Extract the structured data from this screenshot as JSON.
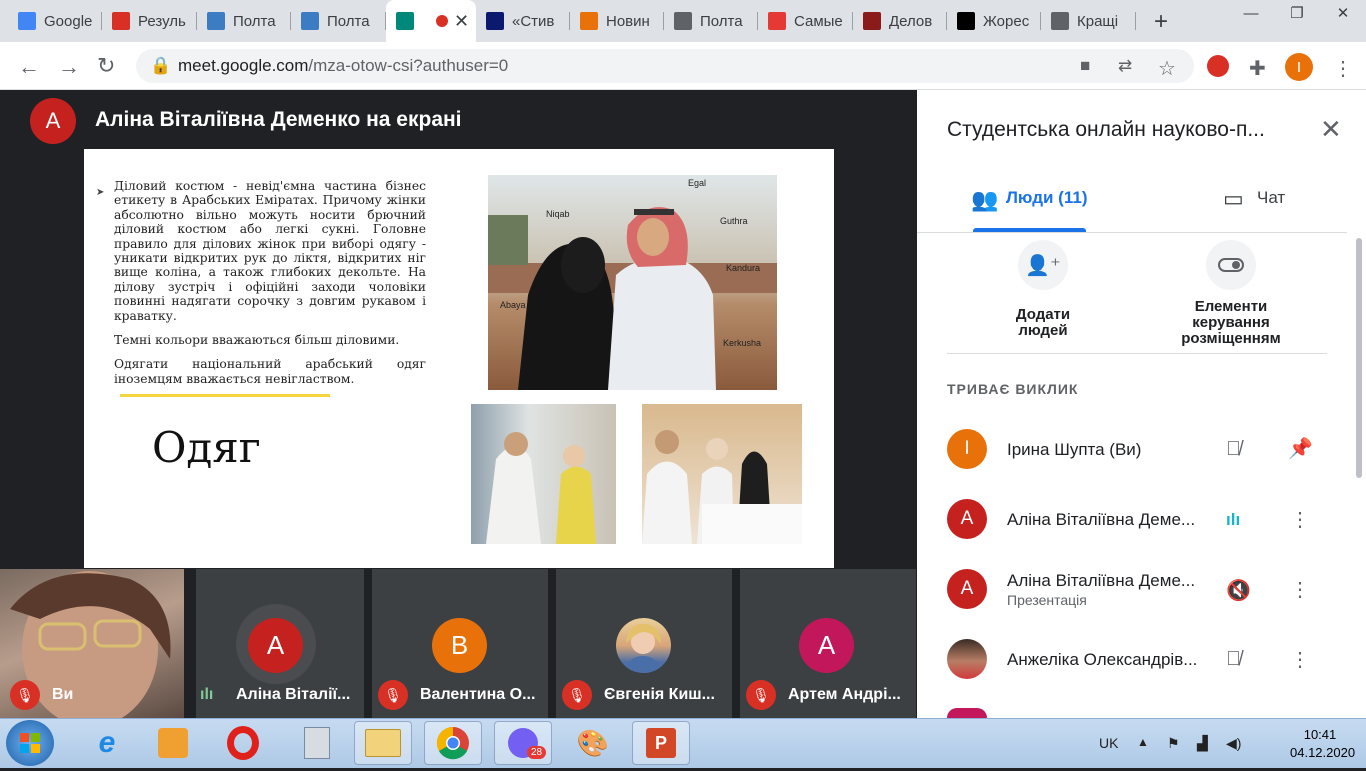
{
  "browser": {
    "tabs": [
      {
        "label": "Google",
        "favicon": "google-icon",
        "color": "#4285f4"
      },
      {
        "label": "Резуль",
        "favicon": "gmail-icon",
        "color": "#d93025"
      },
      {
        "label": "Полта",
        "favicon": "site-4-icon",
        "color": "#3c7cc3"
      },
      {
        "label": "Полта",
        "favicon": "site-4-icon",
        "color": "#3c7cc3"
      },
      {
        "label": "",
        "favicon": "meet-icon",
        "color": "#00897b",
        "active": true
      },
      {
        "label": "«Стив",
        "favicon": "forbes-icon",
        "color": "#0b1a6e"
      },
      {
        "label": "Новин",
        "favicon": "news-icon",
        "color": "#e8710a"
      },
      {
        "label": "Полта",
        "favicon": "globe-icon",
        "color": "#5f6368"
      },
      {
        "label": "Самые",
        "favicon": "card-icon",
        "color": "#e53935"
      },
      {
        "label": "Делов",
        "favicon": "book-icon",
        "color": "#8b1a1a"
      },
      {
        "label": "Жорес",
        "favicon": "wikipedia-icon",
        "color": "#000000"
      },
      {
        "label": "Кращі",
        "favicon": "globe-icon",
        "color": "#5f6368"
      }
    ],
    "url_host": "meet.google.com",
    "url_path": "/mza-otow-csi?authuser=0",
    "profile_initial": "I"
  },
  "presentation": {
    "presenter_initial": "A",
    "title": "Аліна Віталіївна Деменко на екрані",
    "slide": {
      "paragraphs": [
        "Діловий костюм - невід'ємна частина бізнес етикету в Арабських Еміратах. Причому жінки абсолютно вільно можуть носити брючний діловий костюм або легкі сукні. Головне правило для ділових жінок при виборі одягу - уникати відкритих рук до ліктя, відкритих ніг вище коліна, а також глибоких декольте. На ділову зустріч і офіційні заходи чоловіки повинні надягати сорочку з довгим рукавом і краватку.",
        "Темні кольори вважаються більш діловими.",
        "Одягати національний арабський одяг іноземцям вважається невіглаством."
      ],
      "heading": "Одяг",
      "photo_labels": [
        "Egal",
        "Niqab",
        "Guthra",
        "Kandura",
        "Abaya",
        "Kerkusha"
      ]
    }
  },
  "participants_strip": [
    {
      "name": "Ви",
      "initial": "",
      "self": true,
      "muted": true
    },
    {
      "name": "Аліна Віталії...",
      "initial": "A",
      "color": "#c5221f",
      "speaking": true
    },
    {
      "name": "Валентина О...",
      "initial": "B",
      "color": "#e8710a",
      "muted": true
    },
    {
      "name": "Євгенія Киш...",
      "initial": "",
      "photo": true,
      "muted": true
    },
    {
      "name": "Артем Андрі...",
      "initial": "A",
      "color": "#c2185b",
      "muted": true
    }
  ],
  "panel": {
    "title": "Студентська онлайн науково-п...",
    "tab_people": "Люди (11)",
    "tab_chat": "Чат",
    "add_people": "Додати людей",
    "layout_controls": "Елементи керування розміщенням",
    "section_heading": "ТРИВАЄ ВИКЛИК",
    "people": [
      {
        "name": "Ірина Шупта (Ви)",
        "initial": "I",
        "color": "#e8710a",
        "sub": ""
      },
      {
        "name": "Аліна Віталіївна Деме...",
        "initial": "A",
        "color": "#c5221f",
        "sub": ""
      },
      {
        "name": "Аліна Віталіївна Деме...",
        "initial": "A",
        "color": "#c5221f",
        "sub": "Презентація"
      },
      {
        "name": "Анжеліка Олександрів...",
        "initial": "",
        "color": "#6d4c41",
        "sub": ""
      }
    ]
  },
  "taskbar": {
    "lang": "UK",
    "time": "10:41",
    "date": "04.12.2020",
    "viber_badge": "28"
  }
}
